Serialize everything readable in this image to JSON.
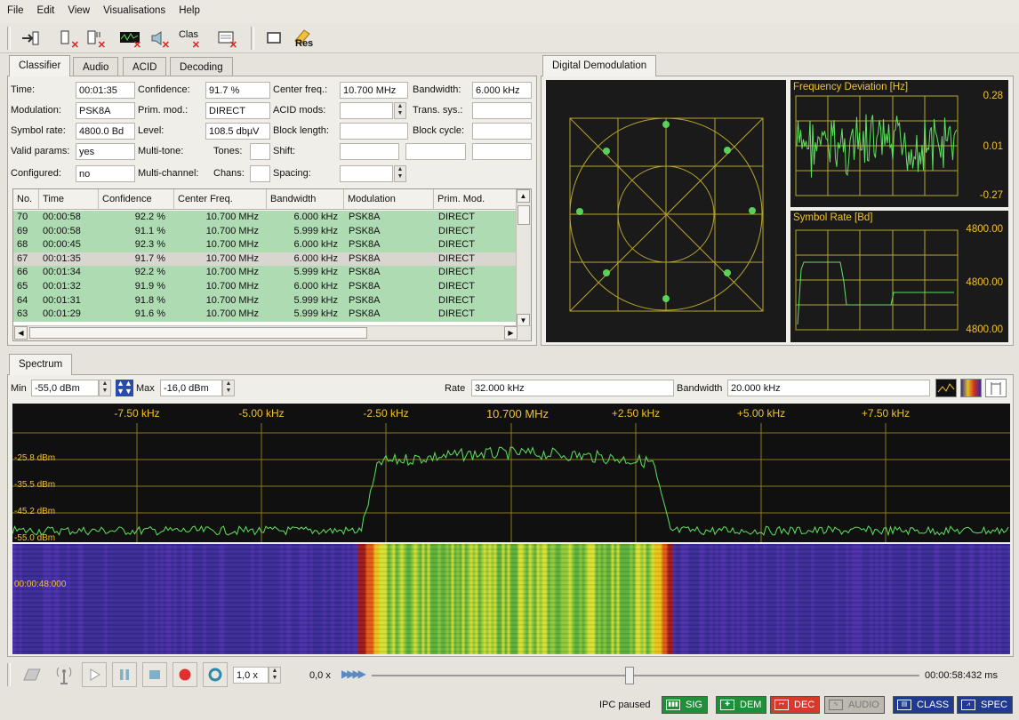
{
  "menu": [
    "File",
    "Edit",
    "View",
    "Visualisations",
    "Help"
  ],
  "toolbar": {
    "class_label": "Clas",
    "res_label": "Res"
  },
  "left_tabs": [
    "Classifier",
    "Audio",
    "ACID",
    "Decoding"
  ],
  "right_tabs": [
    "Digital Demodulation"
  ],
  "classifier": {
    "time_label": "Time:",
    "time": "00:01:35",
    "confidence_label": "Confidence:",
    "confidence": "91.7 %",
    "center_freq_label": "Center freq.:",
    "center_freq": "10.700 MHz",
    "bandwidth_label": "Bandwidth:",
    "bandwidth": "6.000 kHz",
    "modulation_label": "Modulation:",
    "modulation": "PSK8A",
    "prim_mod_label": "Prim. mod.:",
    "prim_mod": "DIRECT",
    "acid_mods_label": "ACID mods:",
    "acid_mods": "",
    "trans_sys_label": "Trans. sys.:",
    "trans_sys": "",
    "symbol_rate_label": "Symbol rate:",
    "symbol_rate": "4800.0 Bd",
    "level_label": "Level:",
    "level": "108.5 dbµV",
    "block_length_label": "Block length:",
    "block_length": "",
    "block_cycle_label": "Block cycle:",
    "block_cycle": "",
    "valid_params_label": "Valid params:",
    "valid_params": "yes",
    "multi_tone_label": "Multi-tone:",
    "multi_tone": "",
    "tones_label": "Tones:",
    "tones": "",
    "shift_label": "Shift:",
    "shift": "",
    "configured_label": "Configured:",
    "configured": "no",
    "multi_channel_label": "Multi-channel:",
    "multi_channel": "",
    "chans_label": "Chans:",
    "chans": "",
    "spacing_label": "Spacing:",
    "spacing": ""
  },
  "table": {
    "headers": [
      "No.",
      "Time",
      "Confidence",
      "Center Freq.",
      "Bandwidth",
      "Modulation",
      "Prim. Mod."
    ],
    "rows": [
      {
        "no": "70",
        "time": "00:00:58",
        "conf": "92.2 %",
        "freq": "10.700 MHz",
        "bw": "6.000 kHz",
        "mod": "PSK8A",
        "prim": "DIRECT",
        "state": "green"
      },
      {
        "no": "69",
        "time": "00:00:58",
        "conf": "91.1 %",
        "freq": "10.700 MHz",
        "bw": "5.999 kHz",
        "mod": "PSK8A",
        "prim": "DIRECT",
        "state": "green"
      },
      {
        "no": "68",
        "time": "00:00:45",
        "conf": "92.3 %",
        "freq": "10.700 MHz",
        "bw": "6.000 kHz",
        "mod": "PSK8A",
        "prim": "DIRECT",
        "state": "green"
      },
      {
        "no": "67",
        "time": "00:01:35",
        "conf": "91.7 %",
        "freq": "10.700 MHz",
        "bw": "6.000 kHz",
        "mod": "PSK8A",
        "prim": "DIRECT",
        "state": "selected"
      },
      {
        "no": "66",
        "time": "00:01:34",
        "conf": "92.2 %",
        "freq": "10.700 MHz",
        "bw": "5.999 kHz",
        "mod": "PSK8A",
        "prim": "DIRECT",
        "state": "green"
      },
      {
        "no": "65",
        "time": "00:01:32",
        "conf": "91.9 %",
        "freq": "10.700 MHz",
        "bw": "6.000 kHz",
        "mod": "PSK8A",
        "prim": "DIRECT",
        "state": "green"
      },
      {
        "no": "64",
        "time": "00:01:31",
        "conf": "91.8 %",
        "freq": "10.700 MHz",
        "bw": "5.999 kHz",
        "mod": "PSK8A",
        "prim": "DIRECT",
        "state": "green"
      },
      {
        "no": "63",
        "time": "00:01:29",
        "conf": "91.6 %",
        "freq": "10.700 MHz",
        "bw": "5.999 kHz",
        "mod": "PSK8A",
        "prim": "DIRECT",
        "state": "green"
      }
    ]
  },
  "freq_dev": {
    "title": "Frequency Deviation [Hz]",
    "y_labels": [
      "0.28",
      "0.01",
      "-0.27"
    ]
  },
  "sym_rate": {
    "title": "Symbol Rate [Bd]",
    "y_labels": [
      "4800.00",
      "4800.00",
      "4800.00"
    ]
  },
  "spectrum_tab": "Spectrum",
  "spectrum_bar": {
    "min_label": "Min",
    "min_value": "-55,0 dBm",
    "max_label": "Max",
    "max_value": "-16,0 dBm",
    "rate_label": "Rate",
    "rate_value": "32.000 kHz",
    "bw_label": "Bandwidth",
    "bw_value": "20.000 kHz"
  },
  "spectrum": {
    "freq_labels": [
      "-7.50 kHz",
      "-5.00 kHz",
      "-2.50 kHz",
      "10.700 MHz",
      "+2.50 kHz",
      "+5.00 kHz",
      "+7.50 kHz"
    ],
    "db_labels": [
      "-25.8 dBm",
      "-35.5 dBm",
      "-45.2 dBm",
      "-55.0 dBm"
    ]
  },
  "waterfall": {
    "time_label": "00:00:48:000"
  },
  "transport": {
    "speed": "1,0 x",
    "position_speed": "0,0 x",
    "time": "00:00:58:432 ms",
    "slider_fraction": 0.47
  },
  "status": {
    "text": "IPC paused",
    "items": [
      {
        "label": "SIG",
        "color": "#1f8f3a"
      },
      {
        "label": "DEM",
        "color": "#1f8f3a"
      },
      {
        "label": "DEC",
        "color": "#d63a2a"
      },
      {
        "label": "AUDIO",
        "color": "#bdb9b1"
      },
      {
        "label": "CLASS",
        "color": "#1f3a8f"
      },
      {
        "label": "SPEC",
        "color": "#1f3a8f"
      }
    ]
  },
  "colors": {
    "row_green": "#aedbb2",
    "row_selected": "#d9d6d0",
    "trace": "#5fe35f",
    "grid": "#b8a530",
    "label": "#f1c232"
  }
}
